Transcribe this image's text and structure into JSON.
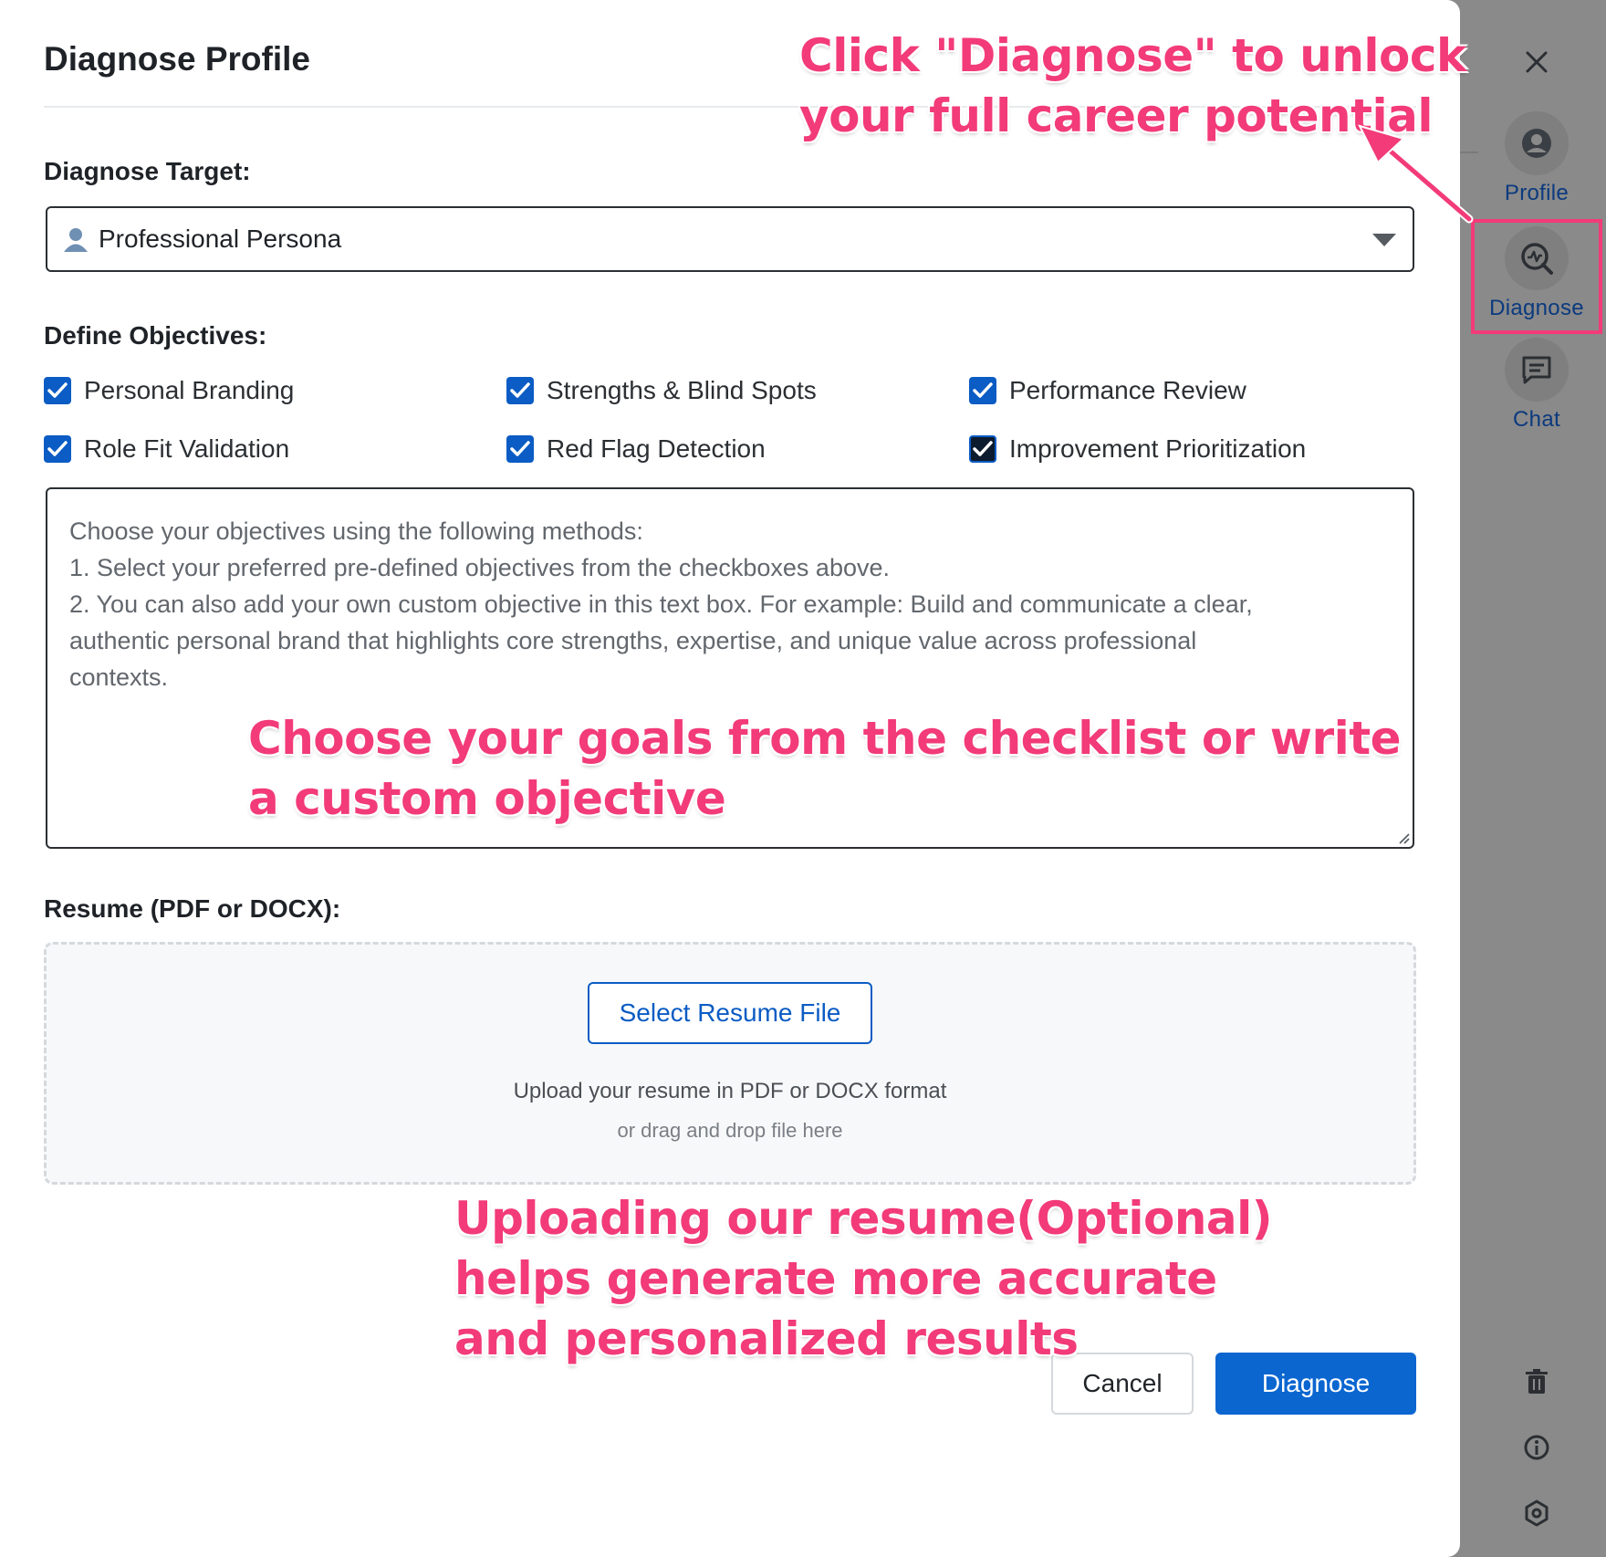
{
  "modal": {
    "title": "Diagnose Profile",
    "target_label": "Diagnose Target:",
    "target_value": "Professional Persona",
    "objectives_label": "Define Objectives:",
    "objectives": [
      {
        "label": "Personal Branding",
        "checked": true
      },
      {
        "label": "Strengths & Blind Spots",
        "checked": true
      },
      {
        "label": "Performance Review",
        "checked": true
      },
      {
        "label": "Role Fit Validation",
        "checked": true
      },
      {
        "label": "Red Flag Detection",
        "checked": true
      },
      {
        "label": "Improvement Prioritization",
        "checked": true
      }
    ],
    "objective_placeholder_lines": [
      "Choose your objectives using the following methods:",
      "1. Select your preferred pre-defined objectives from the checkboxes above.",
      "2. You can also add your own custom objective in this text box. For example: Build and communicate a clear,",
      "authentic personal brand that highlights core strengths, expertise, and unique value across professional",
      "contexts."
    ],
    "resume_label": "Resume (PDF or DOCX):",
    "select_file_button": "Select Resume File",
    "upload_hint": "Upload your resume in PDF or DOCX format",
    "upload_subhint": "or drag and drop file here",
    "cancel_button": "Cancel",
    "diagnose_button": "Diagnose"
  },
  "side_panel": {
    "items": [
      {
        "label": "Profile",
        "icon": "user-circle-icon"
      },
      {
        "label": "Diagnose",
        "icon": "diagnose-search-icon",
        "active": true
      },
      {
        "label": "Chat",
        "icon": "chat-icon"
      }
    ],
    "bottom_icons": [
      "trash-icon",
      "info-icon",
      "settings-icon"
    ]
  },
  "annotations": {
    "top": [
      "Click \"Diagnose\" to unlock",
      "your full career potential"
    ],
    "middle": [
      "Choose your goals from the checklist or write",
      "a custom objective"
    ],
    "bottom": [
      "Uploading our resume(Optional)",
      "helps generate more accurate",
      "and personalized results"
    ]
  },
  "colors": {
    "accent": "#0b66d0",
    "annotation": "#f23b78",
    "overlay": "#8a8a8a"
  }
}
